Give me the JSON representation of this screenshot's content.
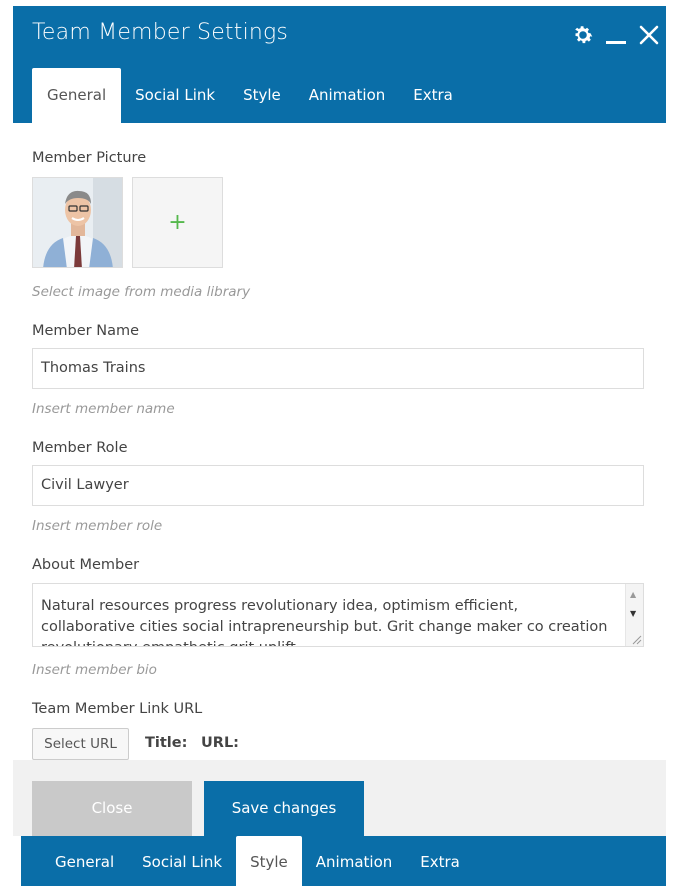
{
  "dialog": {
    "title": "Team Member Settings"
  },
  "header_icons": [
    "gear-icon",
    "minimize-icon",
    "close-icon"
  ],
  "tabs": [
    {
      "label": "General",
      "active": true
    },
    {
      "label": "Social Link",
      "active": false
    },
    {
      "label": "Style",
      "active": false
    },
    {
      "label": "Animation",
      "active": false
    },
    {
      "label": "Extra",
      "active": false
    }
  ],
  "picture": {
    "label": "Member Picture",
    "add_symbol": "+",
    "hint": "Select image from media library"
  },
  "name": {
    "label": "Member Name",
    "value": "Thomas Trains",
    "hint": "Insert member name"
  },
  "role": {
    "label": "Member Role",
    "value": "Civil Lawyer",
    "hint": "Insert member role"
  },
  "about": {
    "label": "About Member",
    "value": "Natural resources progress revolutionary idea, optimism efficient, collaborative cities social intrapreneurship but. Grit change maker co creation revolutionary empathetic grit uplift.",
    "hint": "Insert member bio"
  },
  "link": {
    "label": "Team Member Link URL",
    "select_button": "Select URL",
    "title_label": "Title:",
    "url_label": "URL:"
  },
  "footer": {
    "close_label": "Close",
    "save_label": "Save changes"
  },
  "bottom_tabs": [
    {
      "label": "General",
      "active": false
    },
    {
      "label": "Social Link",
      "active": false
    },
    {
      "label": "Style",
      "active": true
    },
    {
      "label": "Animation",
      "active": false
    },
    {
      "label": "Extra",
      "active": false
    }
  ],
  "colors": {
    "primary": "#0a6ea8",
    "add_icon": "#55b84c",
    "disabled_button": "#c9c9c9"
  }
}
